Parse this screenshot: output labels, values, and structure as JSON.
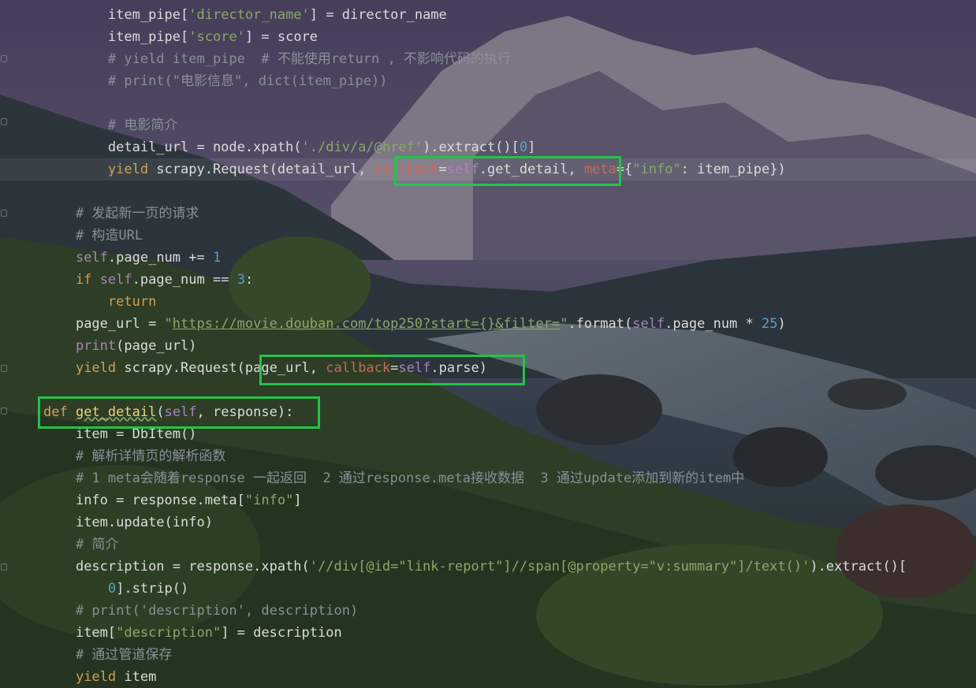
{
  "editor": {
    "language": "python",
    "theme_colors": {
      "keyword": "#d4a056",
      "self": "#a883bf",
      "named_param": "#c86a5a",
      "string": "#8aa86a",
      "number": "#5aa0c8",
      "comment": "#8a8f98",
      "function_def": "#f0d47a",
      "highlight_box": "#22c34a"
    },
    "lines": [
      {
        "indent": "        ",
        "tokens": [
          [
            "item_pipe[",
            ""
          ],
          [
            "'director_name'",
            "str"
          ],
          [
            "] = director_name",
            ""
          ]
        ]
      },
      {
        "indent": "        ",
        "tokens": [
          [
            "item_pipe[",
            ""
          ],
          [
            "'score'",
            "str"
          ],
          [
            "] = score",
            ""
          ]
        ]
      },
      {
        "indent": "        ",
        "tokens": [
          [
            "# yield item_pipe  # 不能使用return , 不影响代码的执行",
            "cmt"
          ]
        ]
      },
      {
        "indent": "        ",
        "tokens": [
          [
            "# print(\"电影信息\", dict(item_pipe))",
            "cmt"
          ]
        ]
      },
      {
        "indent": "",
        "tokens": []
      },
      {
        "indent": "        ",
        "tokens": [
          [
            "# 电影简介",
            "cmt"
          ]
        ]
      },
      {
        "indent": "        ",
        "tokens": [
          [
            "detail_url = node.xpath(",
            ""
          ],
          [
            "'./div/a/@href'",
            "str"
          ],
          [
            ").extract()[",
            ""
          ],
          [
            "0",
            "num"
          ],
          [
            "]",
            ""
          ]
        ]
      },
      {
        "indent": "        ",
        "current": true,
        "tokens": [
          [
            "yield",
            "kw"
          ],
          [
            " scrapy.Request(detail_url, ",
            ""
          ],
          [
            "callback",
            "param"
          ],
          [
            "=",
            ""
          ],
          [
            "self",
            "selfkw"
          ],
          [
            ".get_detail, ",
            ""
          ],
          [
            "meta",
            "param"
          ],
          [
            "={",
            ""
          ],
          [
            "\"info\"",
            "str"
          ],
          [
            ": item_pipe})",
            ""
          ]
        ]
      },
      {
        "indent": "",
        "tokens": []
      },
      {
        "indent": "    ",
        "tokens": [
          [
            "# 发起新一页的请求",
            "cmt"
          ]
        ]
      },
      {
        "indent": "    ",
        "tokens": [
          [
            "# 构造URL",
            "cmt"
          ]
        ]
      },
      {
        "indent": "    ",
        "tokens": [
          [
            "self",
            "selfkw"
          ],
          [
            ".page_num += ",
            ""
          ],
          [
            "1",
            "num"
          ]
        ]
      },
      {
        "indent": "    ",
        "tokens": [
          [
            "if",
            "kw"
          ],
          [
            " ",
            ""
          ],
          [
            "self",
            "selfkw"
          ],
          [
            ".page_num == ",
            ""
          ],
          [
            "3",
            "num"
          ],
          [
            ":",
            ""
          ]
        ]
      },
      {
        "indent": "        ",
        "tokens": [
          [
            "return",
            "kw"
          ]
        ]
      },
      {
        "indent": "    ",
        "tokens": [
          [
            "page_url = ",
            ""
          ],
          [
            "\"",
            "str"
          ],
          [
            "https://movie.douban.com/top250?start={}&filter=",
            "url"
          ],
          [
            "\"",
            "str"
          ],
          [
            ".format(",
            ""
          ],
          [
            "self",
            "selfkw"
          ],
          [
            ".page_num * ",
            ""
          ],
          [
            "25",
            "num"
          ],
          [
            ")",
            ""
          ]
        ]
      },
      {
        "indent": "    ",
        "tokens": [
          [
            "print",
            "selfkw"
          ],
          [
            "(page_url)",
            ""
          ]
        ]
      },
      {
        "indent": "    ",
        "tokens": [
          [
            "yield",
            "kw"
          ],
          [
            " scrapy.Request(page_url, ",
            ""
          ],
          [
            "callback",
            "param"
          ],
          [
            "=",
            ""
          ],
          [
            "self",
            "selfkw"
          ],
          [
            ".parse)",
            ""
          ]
        ]
      },
      {
        "indent": "",
        "tokens": []
      },
      {
        "indent": "",
        "tokens": [
          [
            "def",
            "kw"
          ],
          [
            " ",
            ""
          ],
          [
            "get_detail",
            "fn-sq"
          ],
          [
            "(",
            ""
          ],
          [
            "self",
            "selfkw"
          ],
          [
            ", response):",
            ""
          ]
        ]
      },
      {
        "indent": "    ",
        "tokens": [
          [
            "item = DbItem()",
            ""
          ]
        ]
      },
      {
        "indent": "    ",
        "tokens": [
          [
            "# 解析详情页的解析函数",
            "cmt"
          ]
        ]
      },
      {
        "indent": "    ",
        "tokens": [
          [
            "# 1 meta会随着response 一起返回  2 通过response.meta接收数据  3 通过update添加到新的item中",
            "cmt"
          ]
        ]
      },
      {
        "indent": "    ",
        "tokens": [
          [
            "info = response.meta[",
            ""
          ],
          [
            "\"info\"",
            "str"
          ],
          [
            "]",
            ""
          ]
        ]
      },
      {
        "indent": "    ",
        "tokens": [
          [
            "item.update(info)",
            ""
          ]
        ]
      },
      {
        "indent": "    ",
        "tokens": [
          [
            "# 简介",
            "cmt"
          ]
        ]
      },
      {
        "indent": "    ",
        "tokens": [
          [
            "description = response.xpath(",
            ""
          ],
          [
            "'//div[@id=\"link-report\"]//span[@property=\"v:summary\"]/text()'",
            "str"
          ],
          [
            ").extract()[",
            ""
          ]
        ]
      },
      {
        "indent": "        ",
        "tokens": [
          [
            "0",
            "num"
          ],
          [
            "].strip()",
            ""
          ]
        ]
      },
      {
        "indent": "    ",
        "tokens": [
          [
            "# print('description', description)",
            "cmt"
          ]
        ]
      },
      {
        "indent": "    ",
        "tokens": [
          [
            "item[",
            ""
          ],
          [
            "\"description\"",
            "str"
          ],
          [
            "] = description",
            ""
          ]
        ]
      },
      {
        "indent": "    ",
        "tokens": [
          [
            "# 通过管道保存",
            "cmt"
          ]
        ]
      },
      {
        "indent": "    ",
        "tokens": [
          [
            "yield",
            "kw"
          ],
          [
            " item",
            ""
          ]
        ]
      }
    ]
  }
}
